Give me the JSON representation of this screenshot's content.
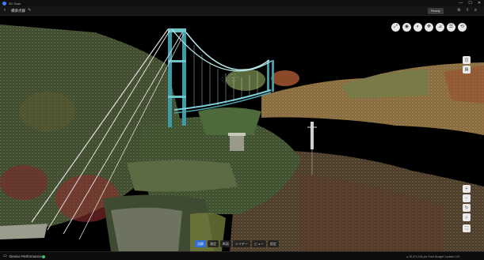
{
  "window": {
    "title": "3D Scan",
    "minimize": "—",
    "maximize": "☐",
    "close": "✕"
  },
  "toolbar": {
    "back_icon": "chevron-left-icon",
    "back": "‹",
    "project_name": "橋梁点群",
    "edit_icon": "pencil-icon",
    "edit": "✎",
    "ready_label": "Ready",
    "settings": "⚙",
    "share": "⇪",
    "menu": "≡"
  },
  "view_tools": [
    {
      "name": "zoom-fit-icon",
      "glyph": "⤢"
    },
    {
      "name": "camera-icon",
      "glyph": "◉"
    },
    {
      "name": "orbit-icon",
      "glyph": "◐"
    },
    {
      "name": "pan-icon",
      "glyph": "✥"
    },
    {
      "name": "measure-icon",
      "glyph": "⊿"
    },
    {
      "name": "layers-icon",
      "glyph": "☰"
    },
    {
      "name": "reset-view-icon",
      "glyph": "⟲"
    }
  ],
  "side_top": [
    {
      "name": "perspective-icon",
      "glyph": "◫"
    },
    {
      "name": "top-view-icon",
      "glyph": "▤"
    }
  ],
  "side_bottom": [
    {
      "name": "zoom-in-icon",
      "glyph": "+"
    },
    {
      "name": "zoom-out-icon",
      "glyph": "−"
    },
    {
      "name": "rotate-icon",
      "glyph": "↻"
    },
    {
      "name": "home-icon",
      "glyph": "⌂"
    },
    {
      "name": "fullscreen-icon",
      "glyph": "⛶"
    }
  ],
  "bottom_tabs": [
    "点群",
    "測定",
    "断面",
    "レイヤー",
    "ビュー",
    "設定"
  ],
  "status": {
    "perf_icon": "monitor-icon",
    "perf_glyph": "▭",
    "perf_label": "Device Performance",
    "right_text": "● 28,374,155 pts  Point Budget  Update 0.00"
  },
  "colors": {
    "accent": "#2f6fd6",
    "bridge": "#8fd2d8",
    "water": "#000000",
    "status_ok": "#3fbf6a"
  }
}
